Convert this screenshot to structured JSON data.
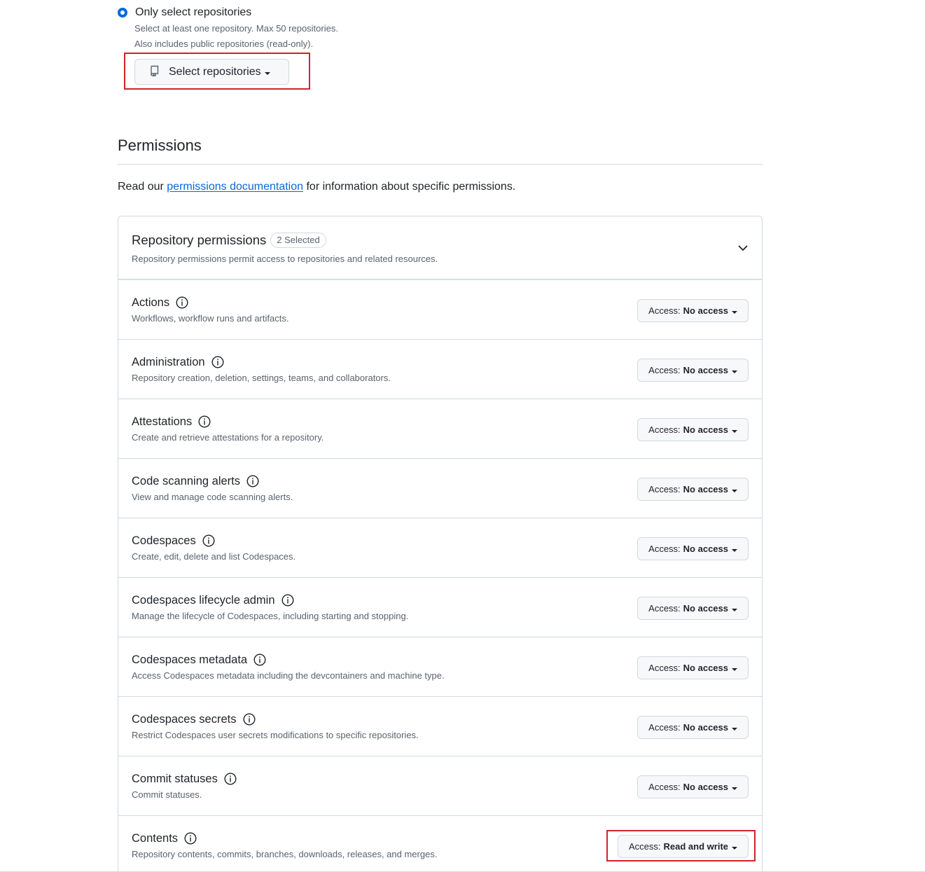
{
  "repo_selection": {
    "radio_label": "Only select repositories",
    "note_1": "Select at least one repository. Max 50 repositories.",
    "note_2": "Also includes public repositories (read-only).",
    "select_button_label": "Select repositories"
  },
  "permissions": {
    "title": "Permissions",
    "intro_prefix": "Read our ",
    "intro_link": "permissions documentation",
    "intro_suffix": " for information about specific permissions."
  },
  "repository_permissions": {
    "title": "Repository permissions",
    "selected_badge": "2 Selected",
    "subtitle": "Repository permissions permit access to repositories and related resources.",
    "access_prefix": "Access:",
    "items": [
      {
        "name": "Actions",
        "desc": "Workflows, workflow runs and artifacts.",
        "access": "No access"
      },
      {
        "name": "Administration",
        "desc": "Repository creation, deletion, settings, teams, and collaborators.",
        "access": "No access"
      },
      {
        "name": "Attestations",
        "desc": "Create and retrieve attestations for a repository.",
        "access": "No access"
      },
      {
        "name": "Code scanning alerts",
        "desc": "View and manage code scanning alerts.",
        "access": "No access"
      },
      {
        "name": "Codespaces",
        "desc": "Create, edit, delete and list Codespaces.",
        "access": "No access"
      },
      {
        "name": "Codespaces lifecycle admin",
        "desc": "Manage the lifecycle of Codespaces, including starting and stopping.",
        "access": "No access"
      },
      {
        "name": "Codespaces metadata",
        "desc": "Access Codespaces metadata including the devcontainers and machine type.",
        "access": "No access"
      },
      {
        "name": "Codespaces secrets",
        "desc": "Restrict Codespaces user secrets modifications to specific repositories.",
        "access": "No access"
      },
      {
        "name": "Commit statuses",
        "desc": "Commit statuses.",
        "access": "No access"
      },
      {
        "name": "Contents",
        "desc": "Repository contents, commits, branches, downloads, releases, and merges.",
        "access": "Read and write"
      }
    ]
  },
  "colors": {
    "accent": "#0969da",
    "highlight_border": "#cf222e",
    "muted_text": "#59636e",
    "border": "#d1d9e0"
  }
}
